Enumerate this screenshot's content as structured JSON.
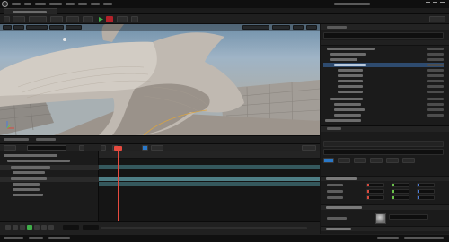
{
  "colors": {
    "accent_blue": "#2e4b6f",
    "play_green": "#3fae49",
    "stop_red": "#b3222a",
    "playhead_red": "#e64a3f",
    "track_teal": "#4f7f86",
    "track_teal_dark": "#35585d"
  },
  "icons": {
    "engine_logo": "ue-logo-icon",
    "play": "play-icon",
    "stop": "stop-icon",
    "settings": "gear-icon",
    "add": "plus-icon",
    "camera": "camera-icon",
    "search": "search-icon"
  }
}
